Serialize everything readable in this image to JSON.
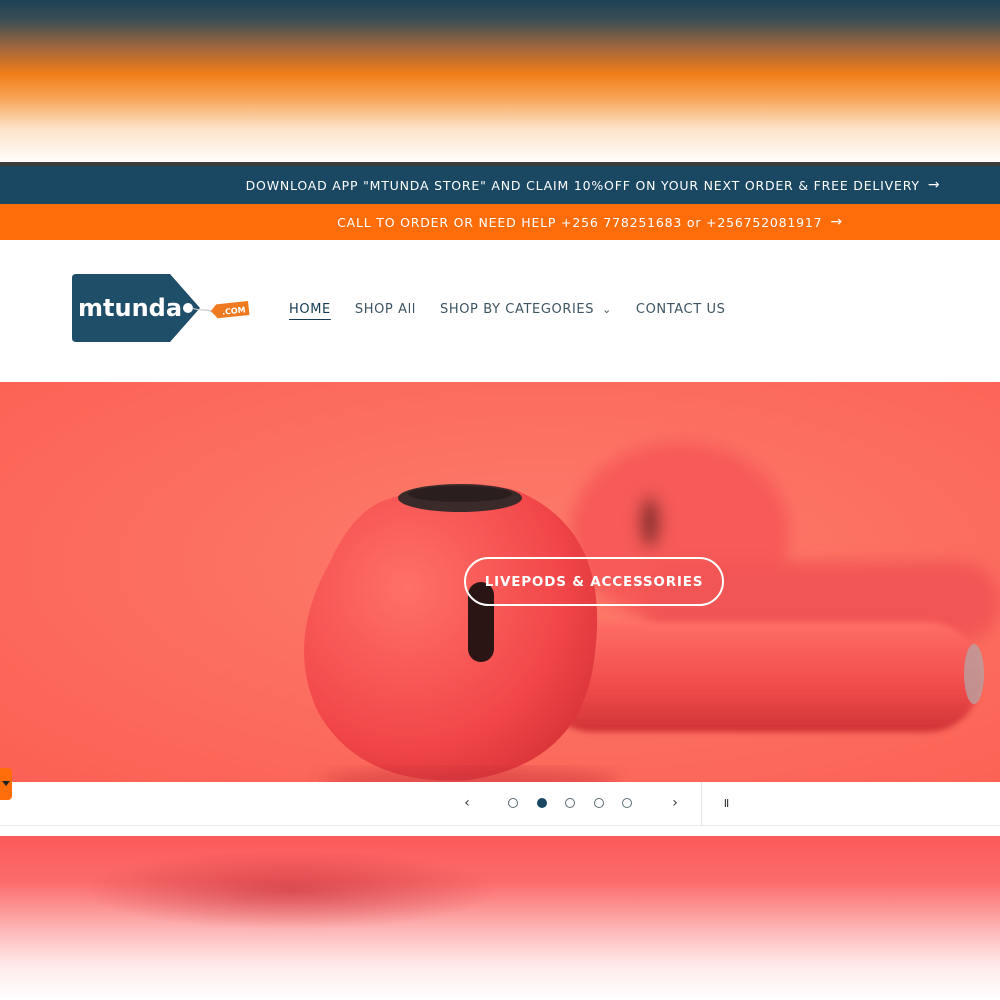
{
  "announcements": [
    {
      "text": "DOWNLOAD APP \"MTUNDA STORE\" AND CLAIM 10%OFF ON YOUR NEXT ORDER & FREE DELIVERY",
      "arrow": "→"
    },
    {
      "text": "CALL TO ORDER OR NEED HELP +256 778251683 or +256752081917",
      "arrow": "→"
    }
  ],
  "logo": {
    "brand": "mtunda",
    "tag": ".COM"
  },
  "nav": {
    "home": "HOME",
    "shop_all": "SHOP All",
    "shop_by_categories": "SHOP BY CATEGORIES",
    "contact": "CONTACT US"
  },
  "hero": {
    "button_label": "LIVEPODS & ACCESSORIES"
  },
  "slider": {
    "prev": "‹",
    "next": "›",
    "pause": "II",
    "slide_count": 5,
    "active_slide": 2
  },
  "colors": {
    "brand_blue": "#1a4762",
    "brand_orange": "#ff6d0a",
    "hero_bg": "#fc6a5c"
  }
}
